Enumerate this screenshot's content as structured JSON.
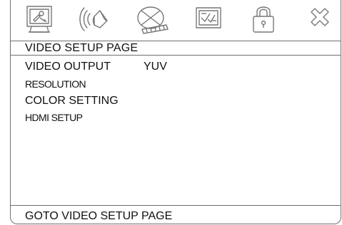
{
  "icons": [
    {
      "name": "general-setup-icon"
    },
    {
      "name": "audio-setup-icon"
    },
    {
      "name": "dolby-disc-icon"
    },
    {
      "name": "video-setup-icon"
    },
    {
      "name": "lock-icon"
    },
    {
      "name": "exit-icon"
    }
  ],
  "page": {
    "title": "VIDEO SETUP PAGE"
  },
  "menu": {
    "items": [
      {
        "label": "VIDEO OUTPUT",
        "value": "YUV"
      },
      {
        "label": "RESOLUTION"
      },
      {
        "label": "COLOR SETTING"
      },
      {
        "label": "HDMI SETUP"
      }
    ]
  },
  "status": {
    "text": "GOTO VIDEO SETUP PAGE"
  },
  "colors": {
    "line": "#6f6f6f",
    "icon_stroke": "#777777",
    "text": "#111111",
    "background": "#ffffff"
  }
}
